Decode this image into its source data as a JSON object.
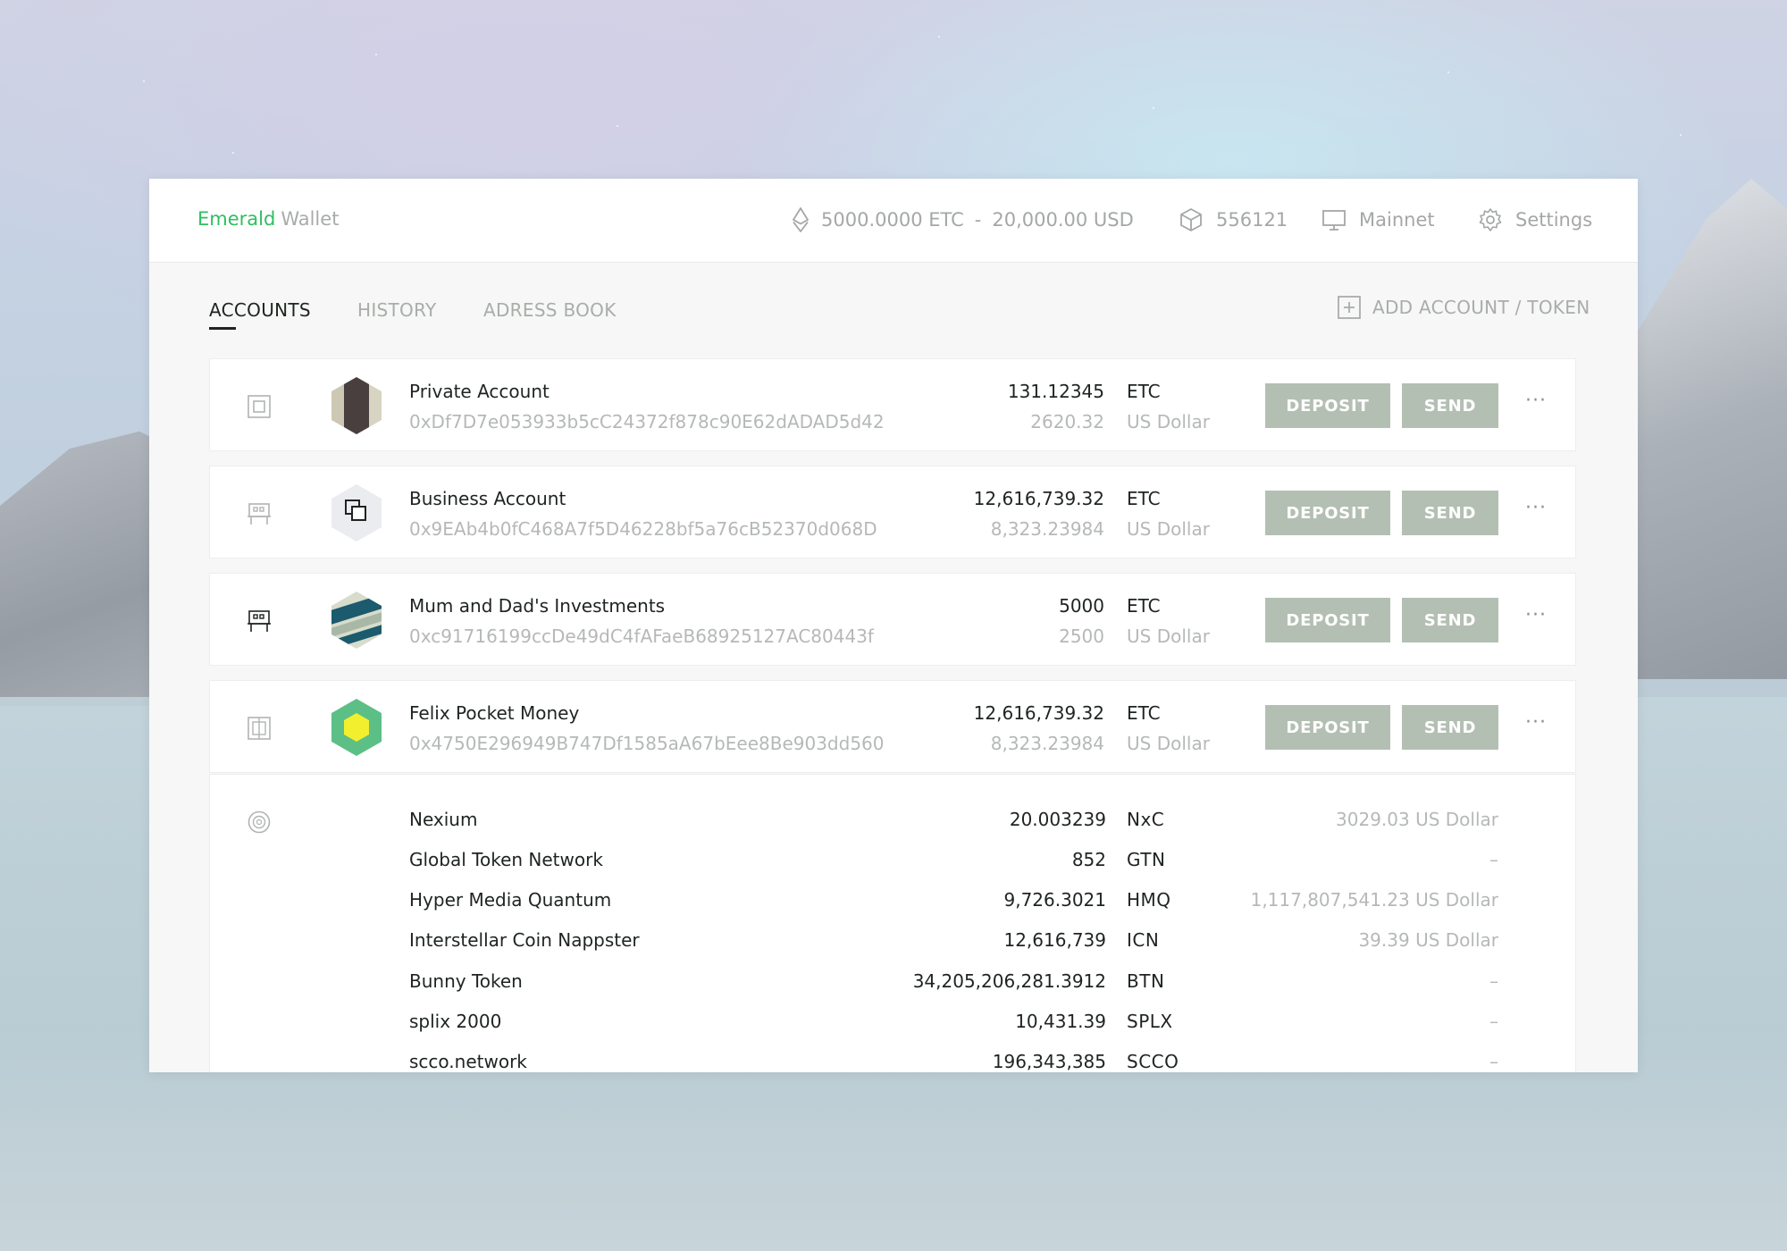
{
  "brand": {
    "primary": "Emerald",
    "secondary": "Wallet"
  },
  "header": {
    "balance_etc": "5000.0000 ETC",
    "separator": "-",
    "balance_usd": "20,000.00 USD",
    "block_number": "556121",
    "network": "Mainnet",
    "settings_label": "Settings"
  },
  "tabs": {
    "accounts": "ACCOUNTS",
    "history": "HISTORY",
    "address_book": "ADRESS BOOK"
  },
  "add_account_label": "ADD ACCOUNT / TOKEN",
  "buttons": {
    "deposit": "DEPOSIT",
    "send": "SEND",
    "more": "···"
  },
  "accounts": [
    {
      "name": "Private Account",
      "address": "0xDf7D7e053933b5cC24372f878c90E62dADAD5d42",
      "balance": "131.12345",
      "currency": "ETC",
      "fiat": "2620.32",
      "fiat_currency": "US Dollar"
    },
    {
      "name": "Business Account",
      "address": "0x9EAb4b0fC468A7f5D46228bf5a76cB52370d068D",
      "balance": "12,616,739.32",
      "currency": "ETC",
      "fiat": "8,323.23984",
      "fiat_currency": "US Dollar"
    },
    {
      "name": "Mum and Dad's Investments",
      "address": "0xc91716199ccDe49dC4fAFaeB68925127AC80443f",
      "balance": "5000",
      "currency": "ETC",
      "fiat": "2500",
      "fiat_currency": "US Dollar"
    },
    {
      "name": "Felix Pocket Money",
      "address": "0x4750E296949B747Df1585aA67bEee8Be903dd560",
      "balance": "12,616,739.32",
      "currency": "ETC",
      "fiat": "8,323.23984",
      "fiat_currency": "US Dollar"
    }
  ],
  "tokens": [
    {
      "name": "Nexium",
      "amount": "20.003239",
      "symbol": "NxC",
      "fiat": "3029.03 US Dollar"
    },
    {
      "name": "Global Token Network",
      "amount": "852",
      "symbol": "GTN",
      "fiat": "–"
    },
    {
      "name": "Hyper Media Quantum",
      "amount": "9,726.3021",
      "symbol": "HMQ",
      "fiat": "1,117,807,541.23 US Dollar"
    },
    {
      "name": "Interstellar Coin Nappster",
      "amount": "12,616,739",
      "symbol": "ICN",
      "fiat": "39.39 US Dollar"
    },
    {
      "name": "Bunny Token",
      "amount": "34,205,206,281.3912",
      "symbol": "BTN",
      "fiat": "–"
    },
    {
      "name": "splix 2000",
      "amount": "10,431.39",
      "symbol": "SPLX",
      "fiat": "–"
    },
    {
      "name": "scco.network",
      "amount": "196,343,385",
      "symbol": "SCCO",
      "fiat": "–"
    }
  ],
  "colors": {
    "brand_green": "#2ebf62",
    "button_bg": "#b4bfb3",
    "muted_text": "#b5b9b6",
    "primary_text": "#1e2420"
  }
}
